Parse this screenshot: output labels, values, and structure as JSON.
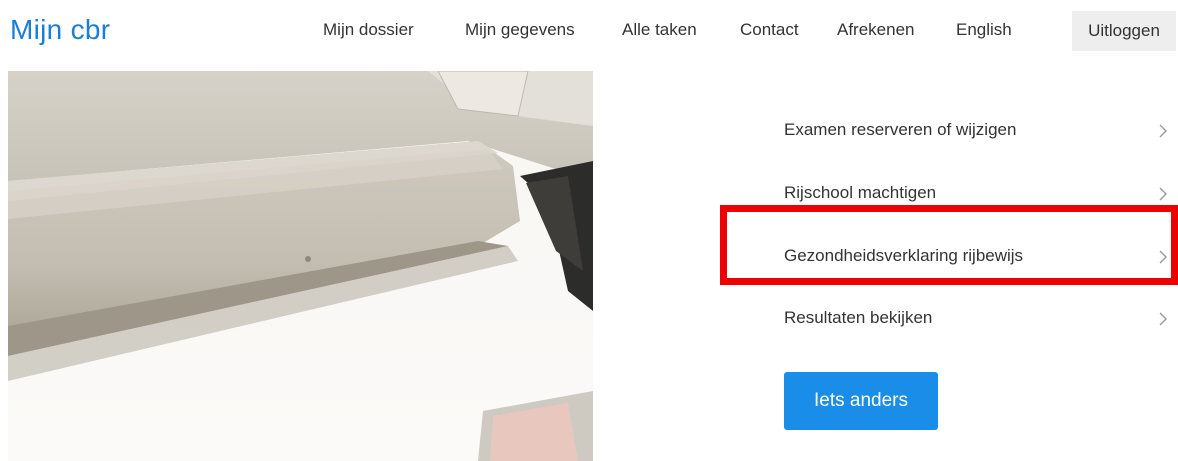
{
  "header": {
    "logo": "Mijn cbr",
    "nav": [
      {
        "id": "dossier",
        "label": "Mijn dossier"
      },
      {
        "id": "gegevens",
        "label": "Mijn gegevens"
      },
      {
        "id": "taken",
        "label": "Alle taken"
      },
      {
        "id": "contact",
        "label": "Contact"
      },
      {
        "id": "afrekenen",
        "label": "Afrekenen"
      },
      {
        "id": "english",
        "label": "English"
      }
    ],
    "logout": "Uitloggen"
  },
  "menu": {
    "items": [
      {
        "label": "Examen reserveren of wijzigen",
        "icon": "chevron-right-icon"
      },
      {
        "label": "Rijschool machtigen",
        "icon": "chevron-right-icon"
      },
      {
        "label": "Gezondheidsverklaring rijbewijs",
        "icon": "chevron-right-icon",
        "highlighted": true
      },
      {
        "label": "Resultaten bekijken",
        "icon": "chevron-right-icon"
      }
    ],
    "other_button": "Iets anders"
  },
  "colors": {
    "brand": "#1a7fd4",
    "button": "#1a8de9",
    "highlight": "#ee0000"
  }
}
